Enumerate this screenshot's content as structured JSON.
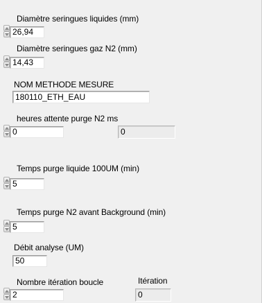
{
  "controls": {
    "diam_liq": {
      "label": "Diamètre seringues liquides (mm)",
      "value": "26,94"
    },
    "diam_gaz": {
      "label": "Diamètre seringues gaz N2 (mm)",
      "value": "14,43"
    },
    "methode": {
      "label": "NOM METHODE MESURE",
      "value": "180110_ETH_EAU"
    },
    "heures": {
      "label": "heures attente purge N2 ms",
      "value": "0",
      "indicator_value": "0"
    },
    "temps_liq": {
      "label": "Temps purge liquide 100UM (min)",
      "value": "5"
    },
    "temps_n2": {
      "label": "Temps purge N2 avant Background (min)",
      "value": "5"
    },
    "debit": {
      "label": "Débit analyse (UM)",
      "value": "50"
    },
    "nombre": {
      "label": "Nombre itération boucle",
      "value": "2"
    },
    "iteration": {
      "label": "Itération",
      "value": "0"
    }
  }
}
